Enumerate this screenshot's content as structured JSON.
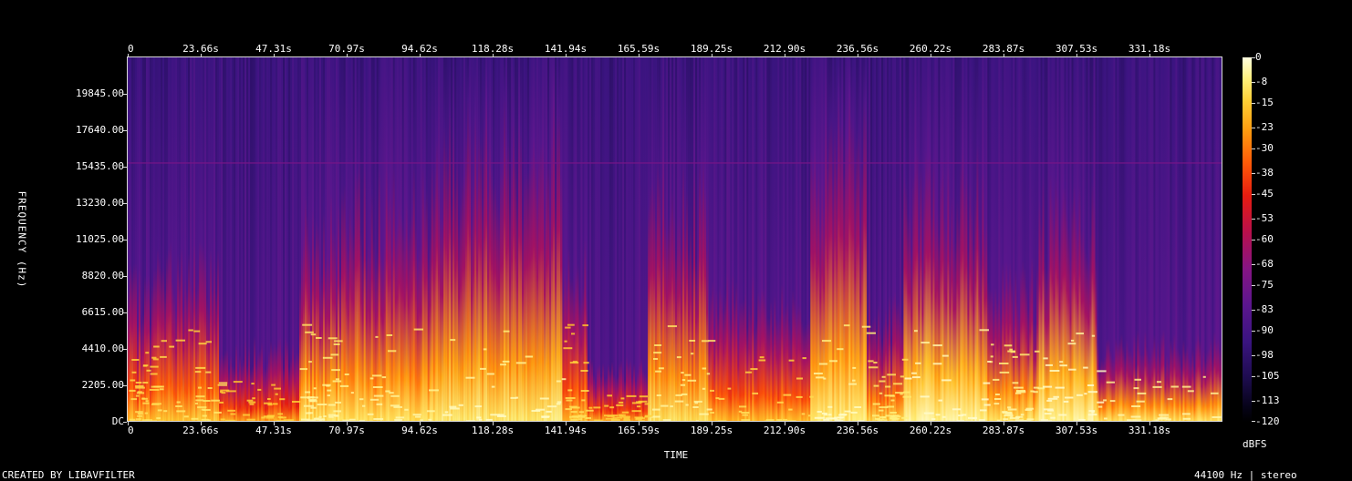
{
  "chart_data": {
    "type": "heatmap",
    "title": "",
    "xlabel": "TIME",
    "ylabel": "FREQUENCY (Hz)",
    "x_ticks": [
      "0",
      "23.66s",
      "47.31s",
      "70.97s",
      "94.62s",
      "118.28s",
      "141.94s",
      "165.59s",
      "189.25s",
      "212.90s",
      "236.56s",
      "260.22s",
      "283.87s",
      "307.53s",
      "331.18s"
    ],
    "x_tick_values": [
      0,
      23.66,
      47.31,
      70.97,
      94.62,
      118.28,
      141.94,
      165.59,
      189.25,
      212.9,
      236.56,
      260.22,
      283.87,
      307.53,
      331.18
    ],
    "xlim": [
      0,
      354.9
    ],
    "y_ticks": [
      "DC",
      "2205.00",
      "4410.00",
      "6615.00",
      "8820.00",
      "11025.00",
      "13230.00",
      "15435.00",
      "17640.00",
      "19845.00"
    ],
    "y_tick_values": [
      0,
      2205,
      4410,
      6615,
      8820,
      11025,
      13230,
      15435,
      17640,
      19845
    ],
    "ylim": [
      0,
      22050
    ],
    "colorbar_label": "dBFS",
    "colorbar_ticks": [
      "0",
      "-8",
      "-15",
      "-23",
      "-30",
      "-38",
      "-45",
      "-53",
      "-60",
      "-68",
      "-75",
      "-83",
      "-90",
      "-98",
      "-105",
      "-113",
      "-120"
    ],
    "colorbar_values": [
      0,
      -8,
      -15,
      -23,
      -30,
      -38,
      -45,
      -53,
      -60,
      -68,
      -75,
      -83,
      -90,
      -98,
      -105,
      -113,
      -120
    ],
    "clim": [
      -120,
      0
    ],
    "colormap": [
      "#000000",
      "#1d0c4e",
      "#3a1480",
      "#5b168e",
      "#861584",
      "#b8104c",
      "#e61c10",
      "#ff5a08",
      "#ff9c10",
      "#ffcf35",
      "#fff07a",
      "#ffffe0"
    ],
    "energy_segments": [
      {
        "start": 0,
        "end": 8.3,
        "ceiling_hz": 4800,
        "peak_dbfs": -25
      },
      {
        "start": 8.3,
        "end": 29.6,
        "ceiling_hz": 5600,
        "peak_dbfs": -22
      },
      {
        "start": 29.6,
        "end": 55.6,
        "ceiling_hz": 2600,
        "peak_dbfs": -30
      },
      {
        "start": 55.6,
        "end": 70.0,
        "ceiling_hz": 7000,
        "peak_dbfs": -15
      },
      {
        "start": 70.0,
        "end": 100.0,
        "ceiling_hz": 8000,
        "peak_dbfs": -15
      },
      {
        "start": 100.0,
        "end": 140.9,
        "ceiling_hz": 10000,
        "peak_dbfs": -12
      },
      {
        "start": 140.9,
        "end": 149.1,
        "ceiling_hz": 6000,
        "peak_dbfs": -25
      },
      {
        "start": 149.1,
        "end": 168.6,
        "ceiling_hz": 2000,
        "peak_dbfs": -30
      },
      {
        "start": 168.6,
        "end": 188.2,
        "ceiling_hz": 8000,
        "peak_dbfs": -15
      },
      {
        "start": 188.2,
        "end": 221.3,
        "ceiling_hz": 4500,
        "peak_dbfs": -25
      },
      {
        "start": 221.3,
        "end": 239.6,
        "ceiling_hz": 10000,
        "peak_dbfs": -12
      },
      {
        "start": 239.6,
        "end": 251.5,
        "ceiling_hz": 4000,
        "peak_dbfs": -20
      },
      {
        "start": 251.5,
        "end": 278.7,
        "ceiling_hz": 8500,
        "peak_dbfs": -8
      },
      {
        "start": 278.7,
        "end": 295.3,
        "ceiling_hz": 5000,
        "peak_dbfs": -15
      },
      {
        "start": 295.3,
        "end": 314.2,
        "ceiling_hz": 7500,
        "peak_dbfs": -8
      },
      {
        "start": 314.2,
        "end": 354.9,
        "ceiling_hz": 2800,
        "peak_dbfs": -15
      }
    ],
    "tonal_line_hz": 15700
  },
  "footer": {
    "left": "CREATED BY LIBAVFILTER",
    "right": "44100 Hz | stereo"
  }
}
